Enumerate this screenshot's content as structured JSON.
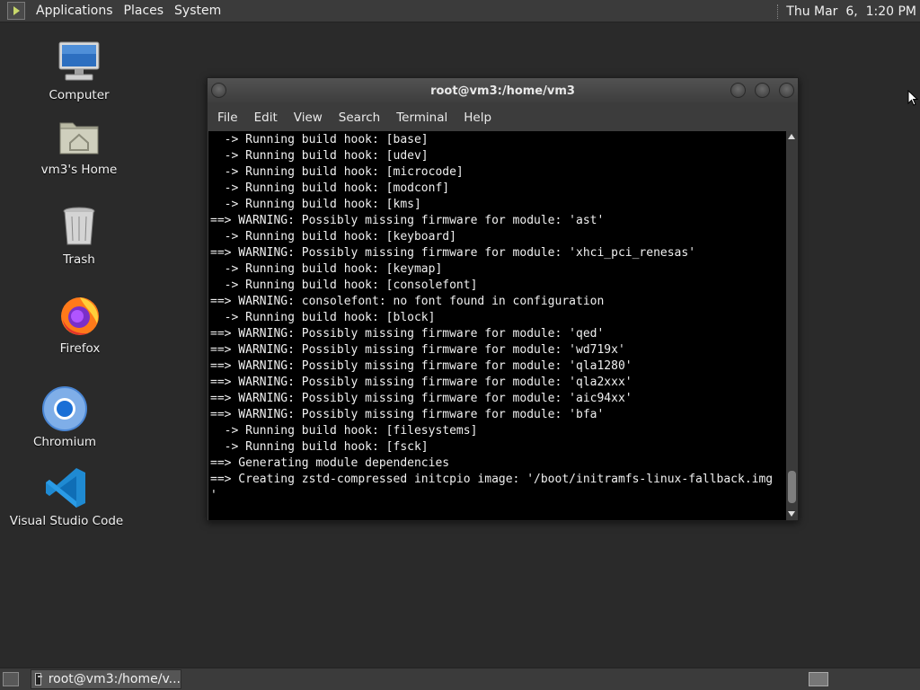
{
  "top_panel": {
    "menus": [
      "Applications",
      "Places",
      "System"
    ],
    "clock": "Thu Mar  6,  1:20 PM"
  },
  "desktop_icons": [
    {
      "label": "Computer",
      "icon": "computer-icon"
    },
    {
      "label": "vm3's Home",
      "icon": "home-folder-icon"
    },
    {
      "label": "Trash",
      "icon": "trash-icon"
    },
    {
      "label": "Firefox",
      "icon": "firefox-icon"
    },
    {
      "label": "Chromium",
      "icon": "chromium-icon"
    },
    {
      "label": "Visual Studio Code",
      "icon": "vscode-icon"
    }
  ],
  "window": {
    "title": "root@vm3:/home/vm3",
    "menus": [
      "File",
      "Edit",
      "View",
      "Search",
      "Terminal",
      "Help"
    ],
    "terminal_lines": [
      "  -> Running build hook: [base]",
      "  -> Running build hook: [udev]",
      "  -> Running build hook: [microcode]",
      "  -> Running build hook: [modconf]",
      "  -> Running build hook: [kms]",
      "==> WARNING: Possibly missing firmware for module: 'ast'",
      "  -> Running build hook: [keyboard]",
      "==> WARNING: Possibly missing firmware for module: 'xhci_pci_renesas'",
      "  -> Running build hook: [keymap]",
      "  -> Running build hook: [consolefont]",
      "==> WARNING: consolefont: no font found in configuration",
      "  -> Running build hook: [block]",
      "==> WARNING: Possibly missing firmware for module: 'qed'",
      "==> WARNING: Possibly missing firmware for module: 'wd719x'",
      "==> WARNING: Possibly missing firmware for module: 'qla1280'",
      "==> WARNING: Possibly missing firmware for module: 'qla2xxx'",
      "==> WARNING: Possibly missing firmware for module: 'aic94xx'",
      "==> WARNING: Possibly missing firmware for module: 'bfa'",
      "  -> Running build hook: [filesystems]",
      "  -> Running build hook: [fsck]",
      "==> Generating module dependencies",
      "==> Creating zstd-compressed initcpio image: '/boot/initramfs-linux-fallback.img",
      "'"
    ]
  },
  "taskbar": {
    "task_label": "root@vm3:/home/v..."
  },
  "colors": {
    "panel": "#3b3b3b",
    "desktop": "#2a2a2a",
    "terminal_bg": "#000000",
    "terminal_fg": "#f0f0f0"
  }
}
